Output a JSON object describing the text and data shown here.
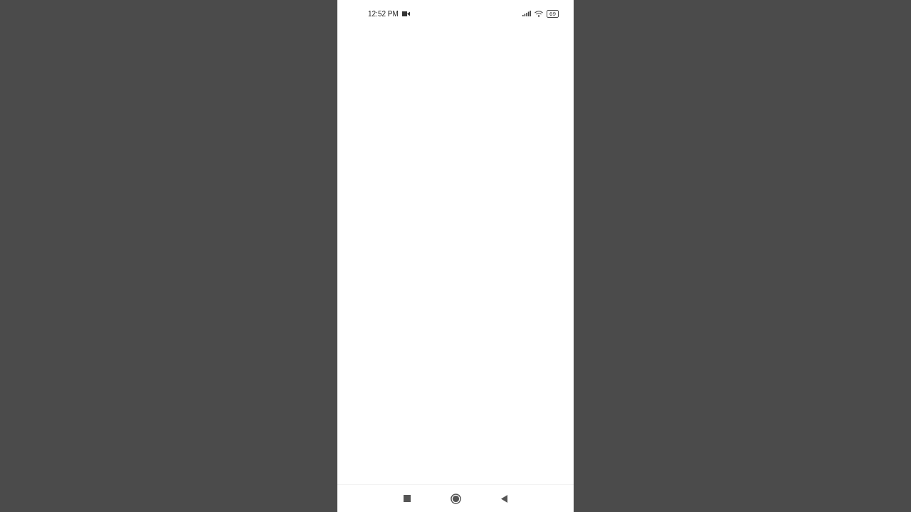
{
  "status_bar": {
    "time": "12:52 PM",
    "battery": "69"
  },
  "nav_bar": {
    "buttons": [
      {
        "kind": "recents"
      },
      {
        "kind": "home"
      },
      {
        "kind": "back"
      }
    ]
  }
}
